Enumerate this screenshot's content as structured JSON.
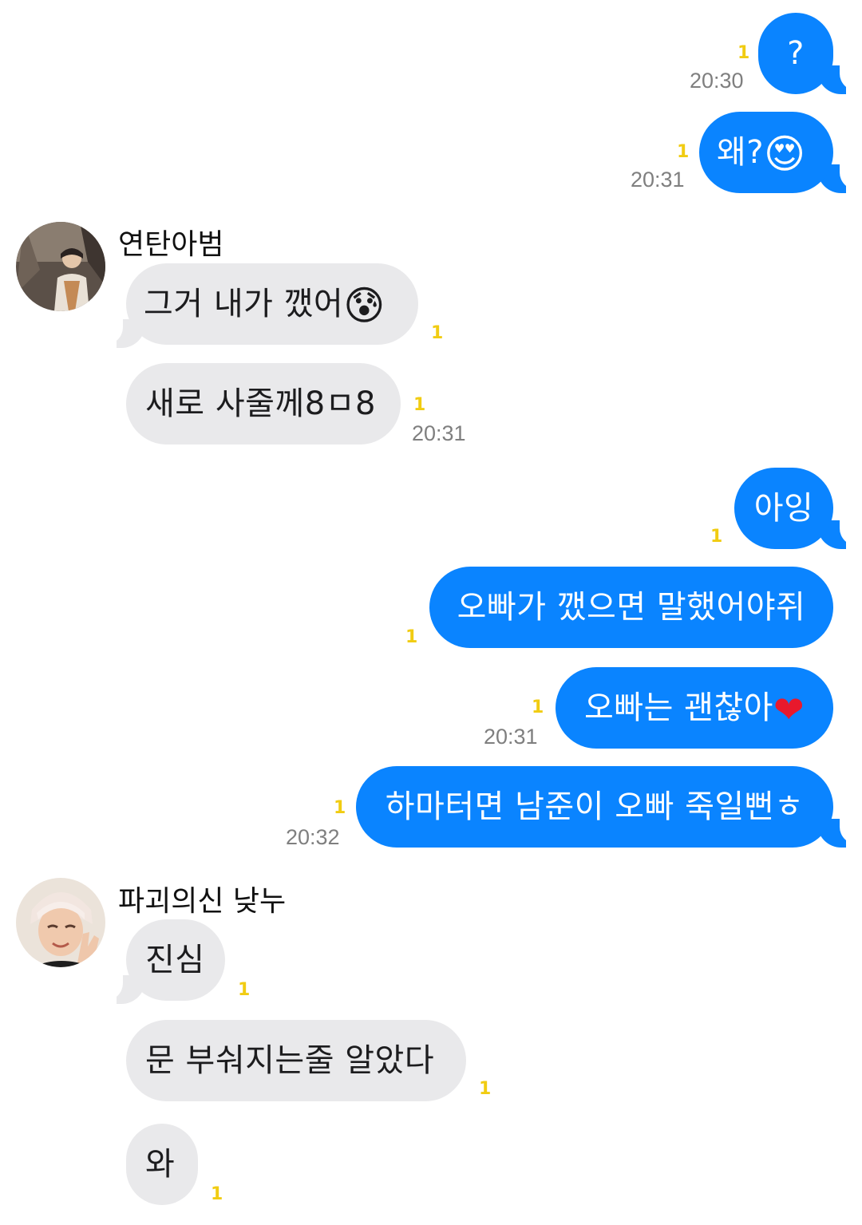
{
  "colors": {
    "outgoing_bubble": "#0a84ff",
    "incoming_bubble": "#e9e9eb",
    "unread_count": "#f1cc12",
    "timestamp": "#7f7f7f"
  },
  "messages": [
    {
      "text": "?",
      "unread": "1",
      "time": "20:30"
    },
    {
      "text": "왜?",
      "emoji": "😍",
      "unread": "1",
      "time": "20:31"
    },
    {
      "text": "그거 내가 깼어",
      "emoji": "😰",
      "unread": "1"
    },
    {
      "text": "새로 사줄께8ㅁ8",
      "unread": "1",
      "time": "20:31"
    },
    {
      "text": "아잉",
      "unread": "1"
    },
    {
      "text": "오빠가 깼으면 말했어야쥐",
      "unread": "1"
    },
    {
      "text": "오빠는 괜찮아",
      "emoji": "❤",
      "unread": "1",
      "time": "20:31"
    },
    {
      "text": "하마터면 남준이 오빠 죽일뻔ㅎ",
      "unread": "1",
      "time": "20:32"
    },
    {
      "text": "진심",
      "unread": "1"
    },
    {
      "text": "문 부숴지는줄 알았다",
      "unread": "1"
    },
    {
      "text": "와",
      "unread": "1"
    }
  ],
  "senders": [
    {
      "name": "연탄아범",
      "avatar_icon": "avatar-photo"
    },
    {
      "name": "파괴의신 낮누",
      "avatar_icon": "avatar-photo"
    }
  ]
}
